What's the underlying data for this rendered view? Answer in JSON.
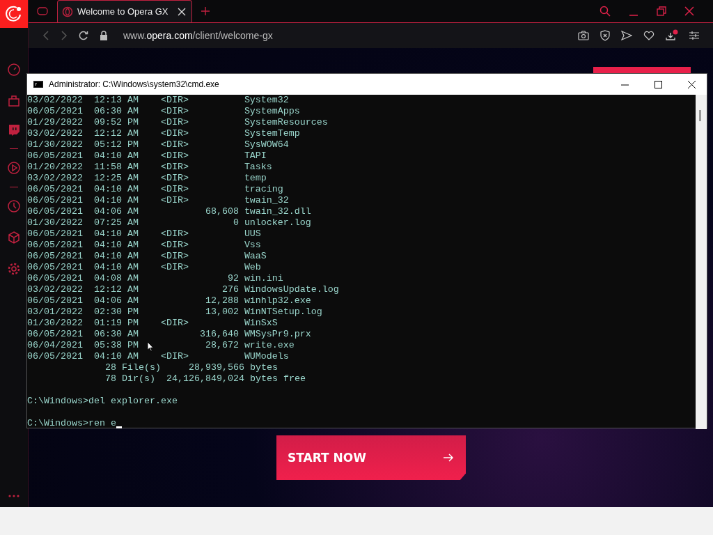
{
  "browser": {
    "tabs": [
      {
        "title": "Welcome to Opera GX",
        "selected": true
      }
    ],
    "address_bar": {
      "url": "www.**opera.com**/client/welcome-gx"
    }
  },
  "page": {
    "button": "START NOW"
  },
  "cmd_window": {
    "title": "Administrator: C:\\Windows\\system32\\cmd.exe",
    "rows": [
      {
        "date": "03/02/2022",
        "time": "12:13 AM",
        "type": "<DIR>",
        "size": "",
        "name": "System32"
      },
      {
        "date": "06/05/2021",
        "time": "06:30 AM",
        "type": "<DIR>",
        "size": "",
        "name": "SystemApps"
      },
      {
        "date": "01/29/2022",
        "time": "09:52 PM",
        "type": "<DIR>",
        "size": "",
        "name": "SystemResources"
      },
      {
        "date": "03/02/2022",
        "time": "12:12 AM",
        "type": "<DIR>",
        "size": "",
        "name": "SystemTemp"
      },
      {
        "date": "01/30/2022",
        "time": "05:12 PM",
        "type": "<DIR>",
        "size": "",
        "name": "SysWOW64"
      },
      {
        "date": "06/05/2021",
        "time": "04:10 AM",
        "type": "<DIR>",
        "size": "",
        "name": "TAPI"
      },
      {
        "date": "01/20/2022",
        "time": "11:58 AM",
        "type": "<DIR>",
        "size": "",
        "name": "Tasks"
      },
      {
        "date": "03/02/2022",
        "time": "12:25 AM",
        "type": "<DIR>",
        "size": "",
        "name": "temp"
      },
      {
        "date": "06/05/2021",
        "time": "04:10 AM",
        "type": "<DIR>",
        "size": "",
        "name": "tracing"
      },
      {
        "date": "06/05/2021",
        "time": "04:10 AM",
        "type": "<DIR>",
        "size": "",
        "name": "twain_32"
      },
      {
        "date": "06/05/2021",
        "time": "04:06 AM",
        "type": "",
        "size": "68,608",
        "name": "twain_32.dll"
      },
      {
        "date": "01/30/2022",
        "time": "07:25 AM",
        "type": "",
        "size": "0",
        "name": "unlocker.log"
      },
      {
        "date": "06/05/2021",
        "time": "04:10 AM",
        "type": "<DIR>",
        "size": "",
        "name": "UUS"
      },
      {
        "date": "06/05/2021",
        "time": "04:10 AM",
        "type": "<DIR>",
        "size": "",
        "name": "Vss"
      },
      {
        "date": "06/05/2021",
        "time": "04:10 AM",
        "type": "<DIR>",
        "size": "",
        "name": "WaaS"
      },
      {
        "date": "06/05/2021",
        "time": "04:10 AM",
        "type": "<DIR>",
        "size": "",
        "name": "Web"
      },
      {
        "date": "06/05/2021",
        "time": "04:08 AM",
        "type": "",
        "size": "92",
        "name": "win.ini"
      },
      {
        "date": "03/02/2022",
        "time": "12:12 AM",
        "type": "",
        "size": "276",
        "name": "WindowsUpdate.log"
      },
      {
        "date": "06/05/2021",
        "time": "04:06 AM",
        "type": "",
        "size": "12,288",
        "name": "winhlp32.exe"
      },
      {
        "date": "03/01/2022",
        "time": "02:30 PM",
        "type": "",
        "size": "13,002",
        "name": "WinNTSetup.log"
      },
      {
        "date": "01/30/2022",
        "time": "01:19 PM",
        "type": "<DIR>",
        "size": "",
        "name": "WinSxS"
      },
      {
        "date": "06/05/2021",
        "time": "06:30 AM",
        "type": "",
        "size": "316,640",
        "name": "WMSysPr9.prx"
      },
      {
        "date": "06/04/2021",
        "time": "05:38 PM",
        "type": "",
        "size": "28,672",
        "name": "write.exe"
      },
      {
        "date": "06/05/2021",
        "time": "04:10 AM",
        "type": "<DIR>",
        "size": "",
        "name": "WUModels"
      }
    ],
    "summary": [
      "28 File(s)     28,939,566 bytes",
      "78 Dir(s)  24,126,849,024 bytes free"
    ],
    "prompts": [
      "C:\\Windows>del explorer.exe",
      "C:\\Windows>ren e"
    ]
  }
}
